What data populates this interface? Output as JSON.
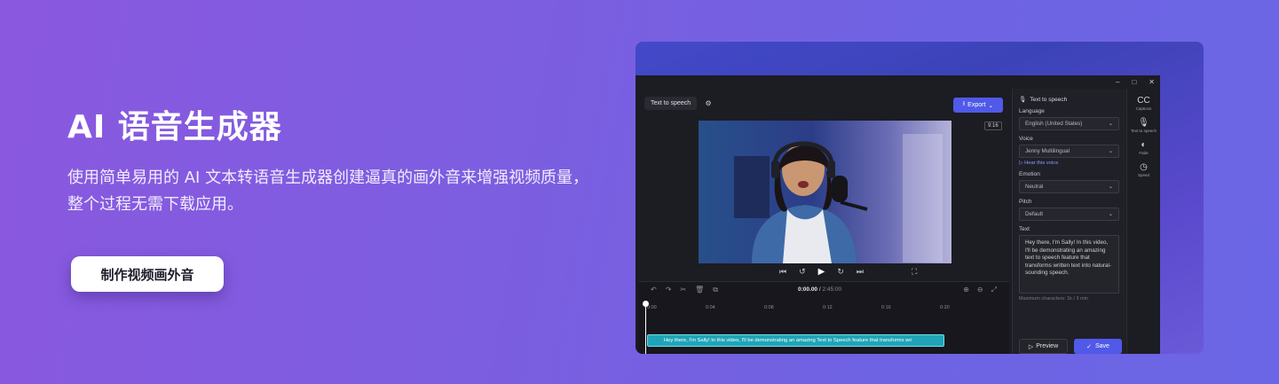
{
  "hero": {
    "title": "AI 语音生成器",
    "description": "使用简单易用的 AI 文本转语音生成器创建逼真的画外音来增强视频质量，整个过程无需下载应用。",
    "cta_label": "制作视频画外音"
  },
  "app": {
    "window_controls": [
      "–",
      "□",
      "✕"
    ],
    "tab_label": "Text to speech",
    "export_label": "Export",
    "ratio_label": "9:16",
    "playback": {
      "prev": "⏮",
      "back5": "↺",
      "play": "▶",
      "fwd5": "↻",
      "next": "⏭",
      "fullscreen": "⛶"
    },
    "timeline": {
      "current_time": "0:00.00",
      "total_time": "2:45:00",
      "ruler": [
        "0:00",
        "0:04",
        "0:08",
        "0:12",
        "0:16",
        "0:20"
      ],
      "clip_text": "Hey there, I'm Sally! In this video, I'll be demonstrating an amazing Text to Speech feature that transforms wri"
    },
    "panel": {
      "title": "Text to speech",
      "language_label": "Language",
      "language_value": "English (United States)",
      "voice_label": "Voice",
      "voice_value": "Jenny Multilingual",
      "hear_voice": "Hear this voice",
      "emotion_label": "Emotion",
      "emotion_value": "Neutral",
      "pitch_label": "Pitch",
      "pitch_value": "Default",
      "text_label": "Text",
      "text_value": "Hey there, I'm Sally! In this video, I'll be demonstrating an amazing text to speech feature that transforms written text into natural-sounding speech.",
      "max_chars": "Maximum characters: 1k / 3 min",
      "preview_label": "Preview",
      "save_label": "Save"
    },
    "rail": [
      {
        "icon": "CC",
        "label": "Captions"
      },
      {
        "icon": "🎙",
        "label": "Text to speech"
      },
      {
        "icon": "◐",
        "label": "Fade"
      },
      {
        "icon": "◷",
        "label": "Speed"
      }
    ]
  }
}
